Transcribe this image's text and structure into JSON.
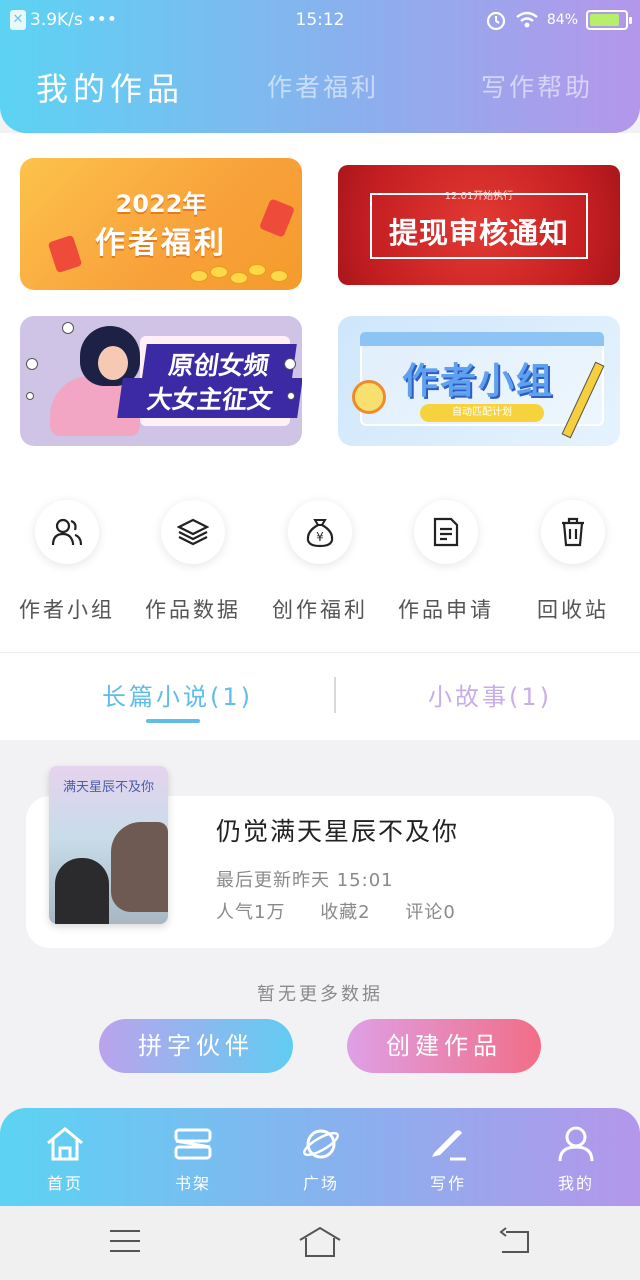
{
  "status_bar": {
    "network_speed": "3.9K/s",
    "dots": "•••",
    "time": "15:12",
    "battery_percent": "84%",
    "battery_level": 0.84
  },
  "header_tabs": [
    {
      "label": "我的作品",
      "active": true
    },
    {
      "label": "作者福利",
      "active": false
    },
    {
      "label": "写作帮助",
      "active": false
    }
  ],
  "banners": {
    "welfare": {
      "line1": "2022年",
      "line2": "作者福利"
    },
    "notice": {
      "small": "12.01开始执行",
      "title": "提现审核通知"
    },
    "contest": {
      "line1": "原创女频",
      "line2": "大女主征文"
    },
    "group": {
      "title": "作者小组",
      "pill": "自动匹配计划"
    }
  },
  "actions": [
    {
      "label": "作者小组",
      "icon": "people-icon"
    },
    {
      "label": "作品数据",
      "icon": "layers-icon"
    },
    {
      "label": "创作福利",
      "icon": "money-bag-icon"
    },
    {
      "label": "作品申请",
      "icon": "document-icon"
    },
    {
      "label": "回收站",
      "icon": "trash-icon"
    }
  ],
  "categories": [
    {
      "label": "长篇小说(1)",
      "active": true
    },
    {
      "label": "小故事(1)",
      "active": false
    }
  ],
  "work": {
    "cover_title": "满天星辰不及你",
    "title": "仍觉满天星辰不及你",
    "updated": "最后更新昨天 15:01",
    "popularity": "人气1万",
    "favorites": "收藏2",
    "comments": "评论0"
  },
  "no_more_text": "暂无更多数据",
  "buttons": {
    "partner": "拼字伙伴",
    "create": "创建作品"
  },
  "bottom_nav": [
    {
      "label": "首页",
      "icon": "home-icon"
    },
    {
      "label": "书架",
      "icon": "bookshelf-icon"
    },
    {
      "label": "广场",
      "icon": "planet-icon"
    },
    {
      "label": "写作",
      "icon": "pen-icon"
    },
    {
      "label": "我的",
      "icon": "user-icon"
    }
  ],
  "colors": {
    "gradient_start": "#5cd3f3",
    "gradient_end": "#b497ea",
    "active_tab": "#5fbde8",
    "inactive_tab": "#c8aee8",
    "create_button": "#f16e87"
  }
}
